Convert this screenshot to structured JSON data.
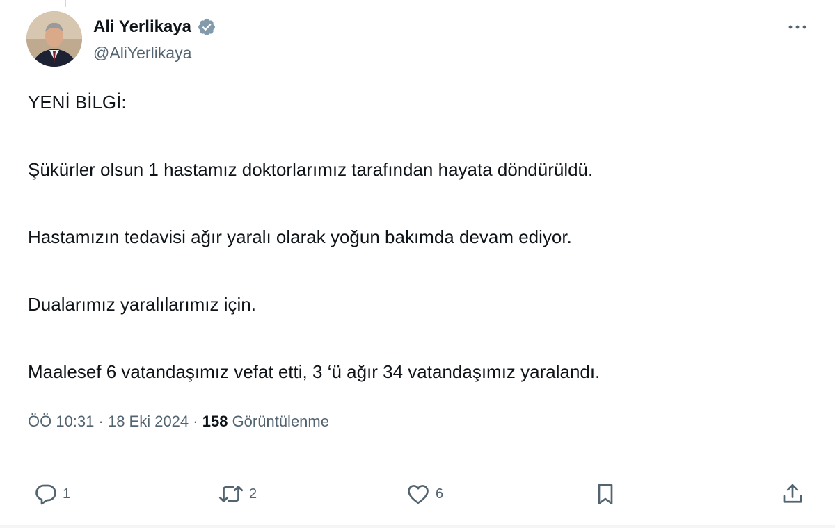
{
  "author": {
    "display_name": "Ali Yerlikaya",
    "handle": "@AliYerlikaya",
    "verified_icon": "verified-badge-icon"
  },
  "tweet": {
    "paragraphs": [
      "YENİ BİLGİ:",
      "Şükürler olsun 1 hastamız doktorlarımız tarafından hayata döndürüldü.",
      "Hastamızın tedavisi ağır yaralı olarak yoğun bakımda devam ediyor.",
      "Dualarımız yaralılarımız için.",
      "Maalesef 6 vatandaşımız vefat etti, 3 ‘ü ağır 34 vatandaşımız yaralandı."
    ]
  },
  "meta": {
    "time": "ÖÖ 10:31",
    "separator": " · ",
    "date": "18 Eki 2024",
    "views_count": "158",
    "views_label": "Görüntülenme"
  },
  "actions": {
    "reply_count": "1",
    "repost_count": "2",
    "like_count": "6"
  },
  "colors": {
    "text": "#0f1419",
    "secondary": "#536471",
    "verified": "#829aab",
    "divider": "#eff3f4"
  }
}
